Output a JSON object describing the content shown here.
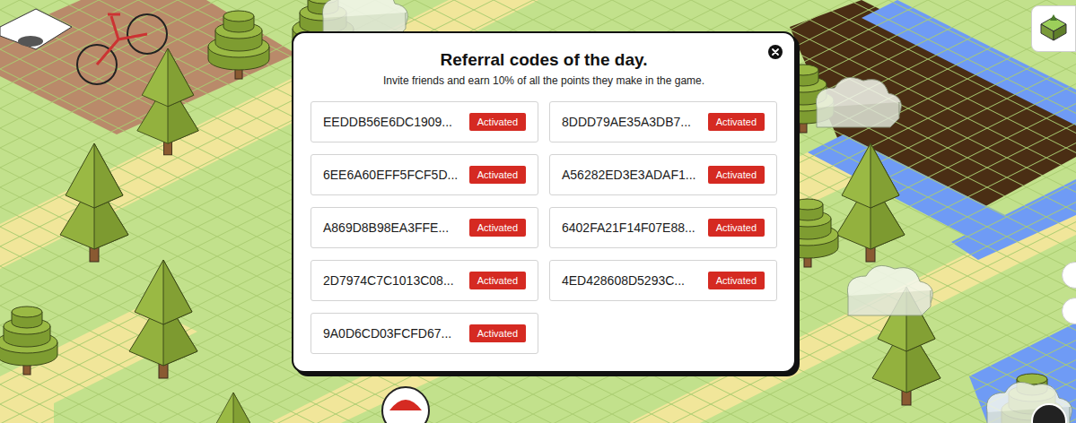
{
  "dialog": {
    "title": "Referral codes of the day.",
    "subtitle": "Invite friends and earn 10% of all the points they make in the game."
  },
  "codes": [
    {
      "code": "EEDDB56E6DC1909...",
      "status": "Activated",
      "activated": true
    },
    {
      "code": "8DDD79AE35A3DB7...",
      "status": "Activated",
      "activated": true
    },
    {
      "code": "6EE6A60EFF5FCF5D...",
      "status": "Activated",
      "activated": true
    },
    {
      "code": "A56282ED3E3ADAF1...",
      "status": "Activated",
      "activated": true
    },
    {
      "code": "A869D8B98EA3FFE...",
      "status": "Activated",
      "activated": true
    },
    {
      "code": "6402FA21F14F07E88...",
      "status": "Activated",
      "activated": true
    },
    {
      "code": "2D7974C7C1013C08...",
      "status": "Activated",
      "activated": true
    },
    {
      "code": "4ED428608D5293C...",
      "status": "Activated",
      "activated": true
    },
    {
      "code": "9A0D6CD03FCFD67...",
      "status": "Activated",
      "activated": true
    }
  ]
}
